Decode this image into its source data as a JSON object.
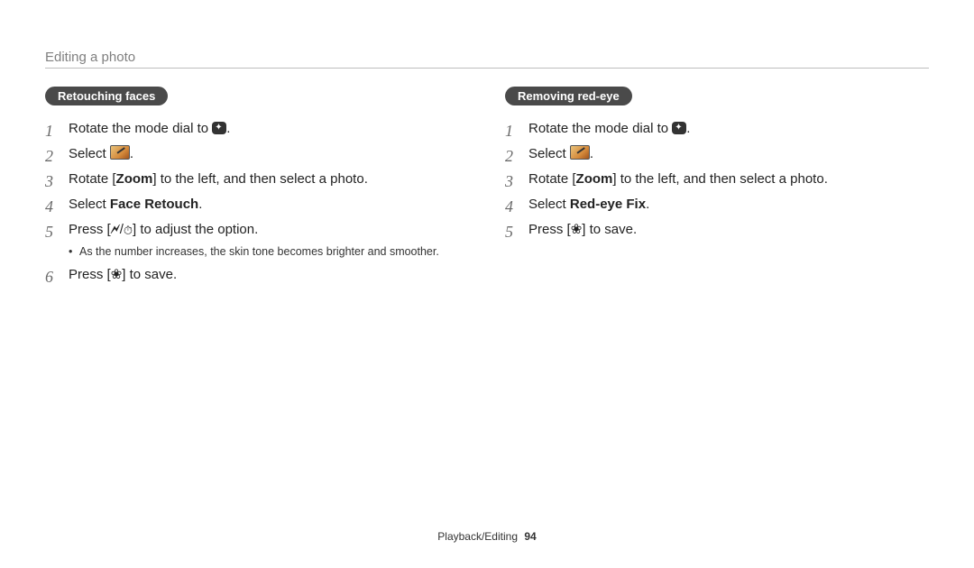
{
  "header": {
    "title": "Editing a photo"
  },
  "left": {
    "heading": "Retouching faces",
    "steps": {
      "s1a": "Rotate the mode dial to ",
      "s1b": ".",
      "s2a": "Select ",
      "s2b": ".",
      "s3a": "Rotate [",
      "s3_zoom": "Zoom",
      "s3b": "] to the left, and then select a photo.",
      "s4a": "Select ",
      "s4b": "Face Retouch",
      "s4c": ".",
      "s5a": "Press [",
      "s5b": "/",
      "s5c": "] to adjust the option.",
      "s5_sub": "As the number increases, the skin tone becomes brighter and smoother.",
      "s6a": "Press [",
      "s6b": "] to save."
    }
  },
  "right": {
    "heading": "Removing red-eye",
    "steps": {
      "s1a": "Rotate the mode dial to ",
      "s1b": ".",
      "s2a": "Select ",
      "s2b": ".",
      "s3a": "Rotate [",
      "s3_zoom": "Zoom",
      "s3b": "] to the left, and then select a photo.",
      "s4a": "Select ",
      "s4b": "Red-eye Fix",
      "s4c": ".",
      "s5a": "Press [",
      "s5b": "] to save."
    }
  },
  "footer": {
    "section": "Playback/Editing",
    "page": "94"
  },
  "icons": {
    "flash": "🗲",
    "timer": "⏱",
    "flower": "❀"
  }
}
